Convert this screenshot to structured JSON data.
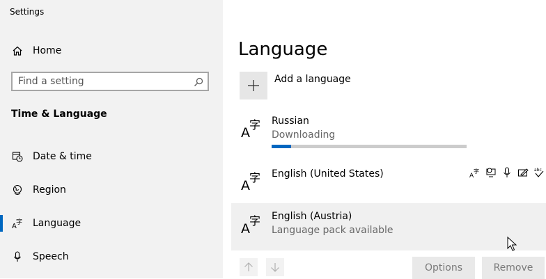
{
  "window": {
    "title": "Settings"
  },
  "sidebar": {
    "home_label": "Home",
    "search_placeholder": "Find a setting",
    "section_title": "Time & Language",
    "items": [
      {
        "label": "Date & time",
        "icon": "calendar-clock-icon"
      },
      {
        "label": "Region",
        "icon": "globe-icon"
      },
      {
        "label": "Language",
        "icon": "language-icon",
        "active": true
      },
      {
        "label": "Speech",
        "icon": "microphone-icon"
      }
    ]
  },
  "main": {
    "title": "Language",
    "add_label": "Add a language",
    "languages": [
      {
        "name": "Russian",
        "status": "Downloading",
        "progress": 0.1
      },
      {
        "name": "English (United States)",
        "status": ""
      },
      {
        "name": "English (Austria)",
        "status": "Language pack available",
        "selected": true
      }
    ],
    "feature_icons": [
      "display-language-icon",
      "text-to-speech-icon",
      "speech-recognition-icon",
      "handwriting-icon",
      "spelling-icon"
    ],
    "options_label": "Options",
    "remove_label": "Remove"
  },
  "colors": {
    "accent": "#0067c0",
    "sidebar_bg": "#f2f2f2",
    "selected_row": "#f0f0f0"
  }
}
